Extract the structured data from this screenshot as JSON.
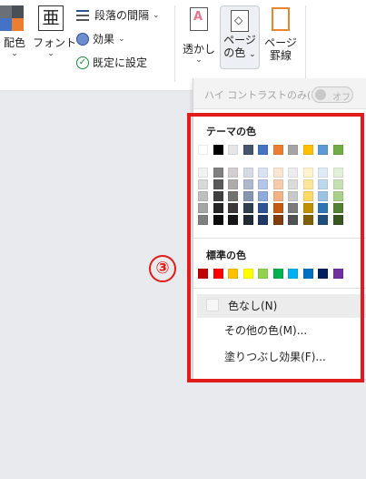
{
  "ribbon": {
    "color_scheme_label": "配色",
    "font_label": "フォント",
    "font_glyph": "亜",
    "paragraph_spacing_label": "段落の間隔",
    "effects_label": "効果",
    "set_default_label": "既定に設定",
    "watermark_label": "透かし",
    "page_color_label_line1": "ページ",
    "page_color_label_line2": "の色",
    "page_borders_label_line1": "ページ",
    "page_borders_label_line2": "罫線",
    "caret": "⌄"
  },
  "panel": {
    "high_contrast_label": "ハイ コントラストのみ(H)",
    "high_contrast_toggle_text": "オフ",
    "theme_colors_title": "テーマの色",
    "standard_colors_title": "標準の色",
    "no_color_label": "色なし(N)",
    "more_colors_label": "その他の色(M)...",
    "fill_effects_label": "塗りつぶし効果(F)..."
  },
  "theme_colors": {
    "base": [
      "#ffffff",
      "#000000",
      "#e7e6e6",
      "#44546a",
      "#4472c4",
      "#ed7d31",
      "#a5a5a5",
      "#ffc000",
      "#5b9bd5",
      "#70ad47"
    ],
    "tints": [
      [
        "#f2f2f2",
        "#7f7f7f",
        "#d0cece",
        "#d6dce4",
        "#d9e2f3",
        "#fbe5d5",
        "#ededed",
        "#fff2cc",
        "#deebf6",
        "#e2efd9"
      ],
      [
        "#d8d8d8",
        "#595959",
        "#aeabab",
        "#adb9ca",
        "#b4c6e7",
        "#f7cbac",
        "#dbdbdb",
        "#fee599",
        "#bdd7ee",
        "#c5e0b3"
      ],
      [
        "#bfbfbf",
        "#3f3f3f",
        "#757070",
        "#8496b0",
        "#8eaadb",
        "#f4b183",
        "#c9c9c9",
        "#ffd965",
        "#9cc3e5",
        "#a8d08d"
      ],
      [
        "#a5a5a5",
        "#262626",
        "#3a3838",
        "#323f4f",
        "#2f5496",
        "#c55a11",
        "#7b7b7b",
        "#bf9000",
        "#2e75b5",
        "#538135"
      ],
      [
        "#7f7f7f",
        "#0c0c0c",
        "#171616",
        "#222a35",
        "#1f3864",
        "#833c0b",
        "#525252",
        "#7f6000",
        "#1e4e79",
        "#375623"
      ]
    ]
  },
  "standard_colors": [
    "#c00000",
    "#ff0000",
    "#ffc000",
    "#ffff00",
    "#92d050",
    "#00b050",
    "#00b0f0",
    "#0070c0",
    "#002060",
    "#7030a0"
  ],
  "annotation": {
    "step_label": "③",
    "frame_color": "#e21b1b"
  }
}
